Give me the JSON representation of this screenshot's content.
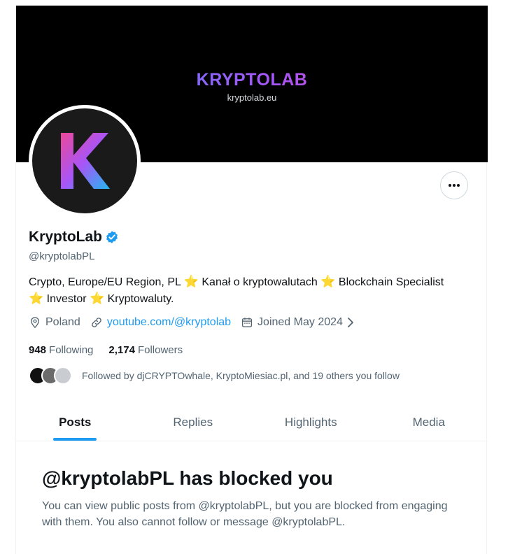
{
  "banner": {
    "title": "KRYPTOLAB",
    "subtitle": "kryptolab.eu"
  },
  "profile": {
    "name": "KryptoLab",
    "handle": "@kryptolabPL",
    "bio_parts": [
      "Crypto, Europe/EU Region, PL",
      "Kanał o kryptowalutach",
      "Blockchain Specialist",
      "Investor",
      "Kryptowaluty."
    ],
    "star": "⭐",
    "location": "Poland",
    "website": "youtube.com/@kryptolab",
    "joined": "Joined May 2024",
    "following_count": "948",
    "following_label": "Following",
    "followers_count": "2,174",
    "followers_label": "Followers",
    "followed_by": "Followed by djCRYPTOwhale, KryptoMiesiac.pl, and 19 others you follow"
  },
  "tabs": [
    {
      "label": "Posts"
    },
    {
      "label": "Replies"
    },
    {
      "label": "Highlights"
    },
    {
      "label": "Media"
    }
  ],
  "blocked": {
    "title": "@kryptolabPL has blocked you",
    "text": "You can view public posts from @kryptolabPL, but you are blocked from engaging with them. You also cannot follow or message @kryptolabPL."
  },
  "colors": {
    "accent": "#1d9bf0",
    "secondary_text": "#536471",
    "primary_text": "#0f1419"
  },
  "icons": [
    "more-icon",
    "verified-badge-icon",
    "location-pin-icon",
    "link-icon",
    "calendar-icon",
    "chevron-right-icon"
  ]
}
